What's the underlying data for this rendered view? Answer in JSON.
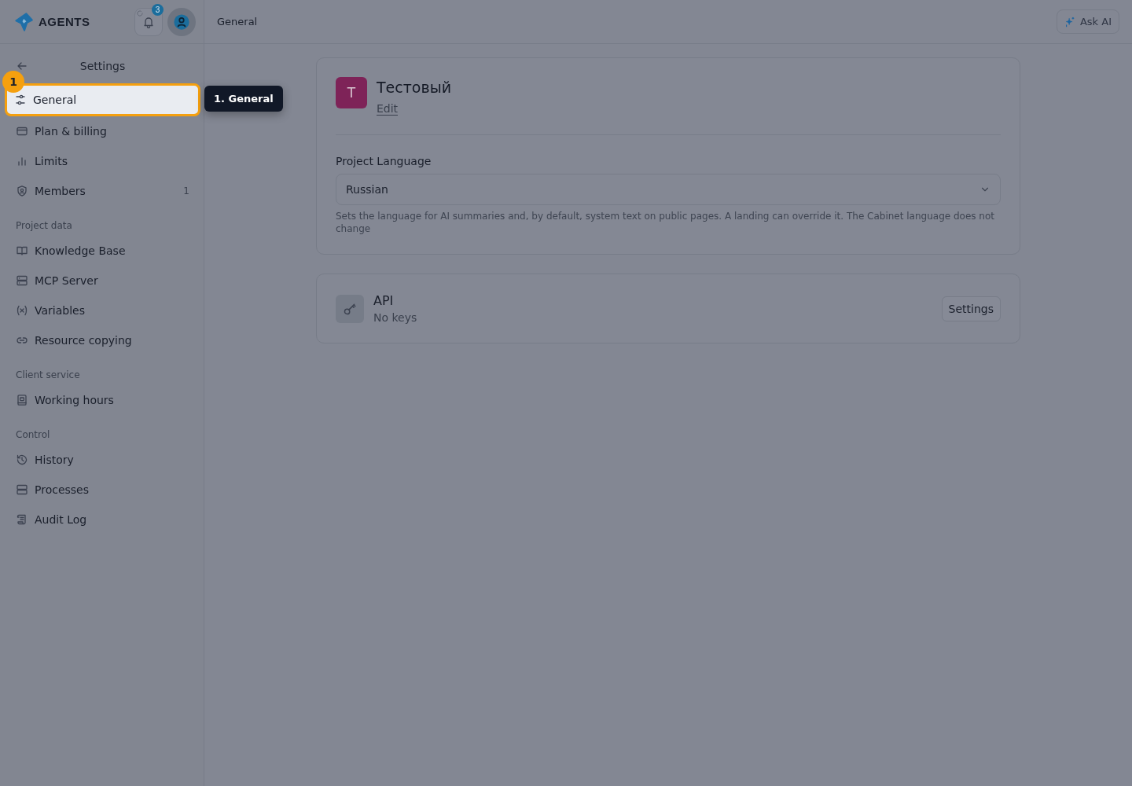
{
  "brand": {
    "name": "AGENTS"
  },
  "notifications": {
    "count": "3",
    "loading": true
  },
  "sidebar": {
    "title": "Settings",
    "groups": [
      {
        "items": [
          {
            "label": "General",
            "selected": true
          },
          {
            "label": "Plan & billing",
            "selected": false
          },
          {
            "label": "Limits",
            "selected": false
          },
          {
            "label": "Members",
            "selected": false,
            "count": "1"
          }
        ]
      },
      {
        "heading": "Project data",
        "items": [
          {
            "label": "Knowledge Base",
            "selected": false
          },
          {
            "label": "MCP Server",
            "selected": false
          },
          {
            "label": "Variables",
            "selected": false
          },
          {
            "label": "Resource copying",
            "selected": false
          }
        ]
      },
      {
        "heading": "Client service",
        "items": [
          {
            "label": "Working hours",
            "selected": false
          }
        ]
      },
      {
        "heading": "Control",
        "items": [
          {
            "label": "History",
            "selected": false
          },
          {
            "label": "Processes",
            "selected": false
          },
          {
            "label": "Audit Log",
            "selected": false
          }
        ]
      }
    ]
  },
  "breadcrumb": "General",
  "ask_ai": "Ask AI",
  "project": {
    "initial": "T",
    "color": "#7e2358",
    "name": "Тестовый",
    "edit": "Edit",
    "language_label": "Project Language",
    "language": "Russian",
    "help": "Sets the language for AI summaries and, by default, system text on public pages. A landing can override it. The Cabinet language does not change"
  },
  "api": {
    "title": "API",
    "status": "No keys",
    "button": "Settings"
  },
  "tour": {
    "step": "1",
    "tooltip": "1. General"
  }
}
